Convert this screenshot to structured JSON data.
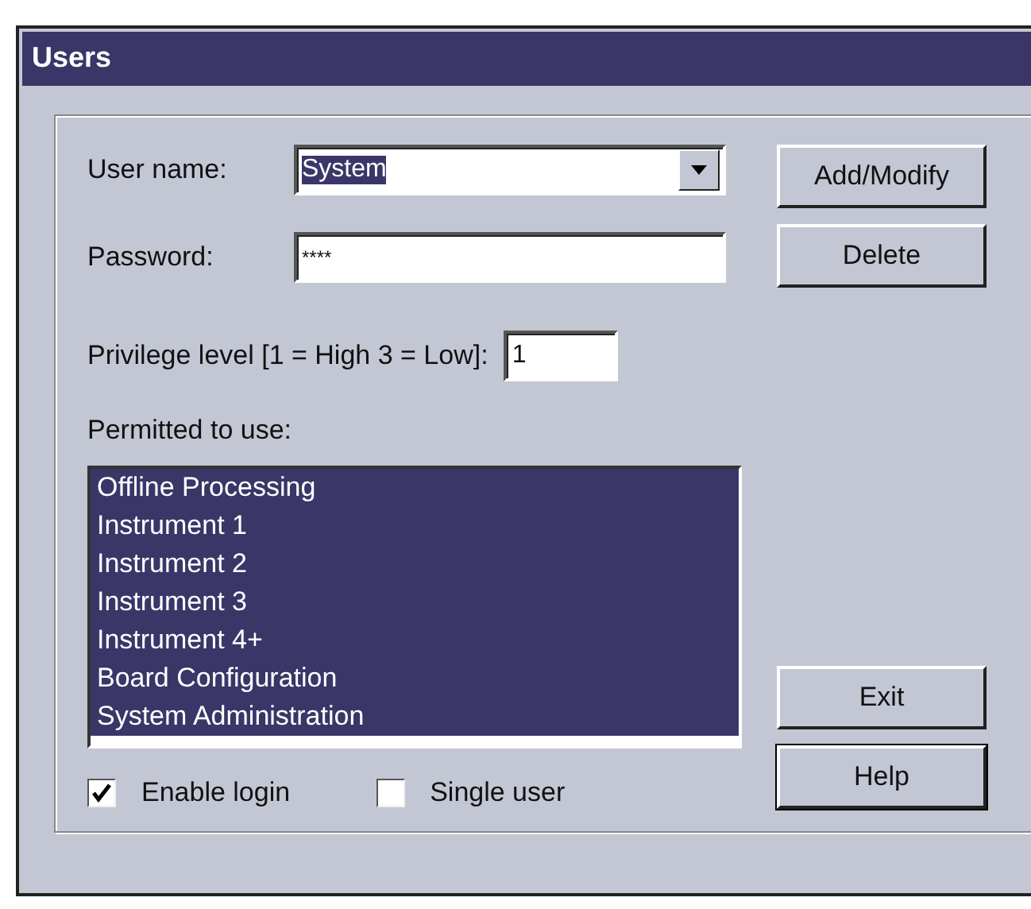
{
  "window": {
    "title": "Users"
  },
  "user_name": {
    "label": "User name:",
    "value": "System",
    "value_selected": true
  },
  "password": {
    "label": "Password:",
    "value": "****"
  },
  "privilege": {
    "label": "Privilege level [1 = High 3 = Low]:",
    "value": "1"
  },
  "permitted": {
    "label": "Permitted to use:",
    "items": [
      {
        "label": "Offline Processing",
        "selected": true
      },
      {
        "label": "Instrument 1",
        "selected": true
      },
      {
        "label": "Instrument 2",
        "selected": true
      },
      {
        "label": "Instrument 3",
        "selected": true
      },
      {
        "label": "Instrument 4+",
        "selected": true
      },
      {
        "label": "Board Configuration",
        "selected": true
      },
      {
        "label": "System Administration",
        "selected": true
      }
    ]
  },
  "checkboxes": [
    {
      "label": "Enable login",
      "checked": true
    },
    {
      "label": "Single user",
      "checked": false
    }
  ],
  "buttons_top": [
    {
      "label": "Add/Modify",
      "default": false
    },
    {
      "label": "Delete",
      "default": false
    }
  ],
  "buttons_bottom": [
    {
      "label": "Exit",
      "default": false
    },
    {
      "label": "Help",
      "default": true
    }
  ]
}
